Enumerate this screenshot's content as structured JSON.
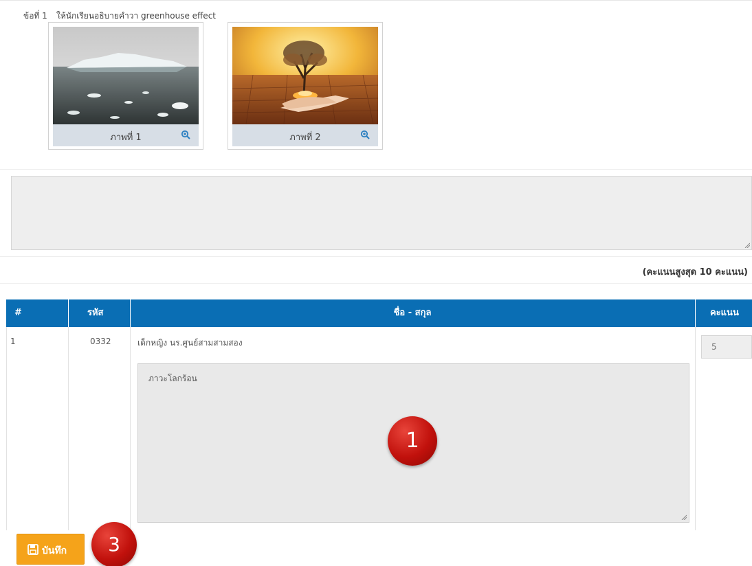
{
  "question": {
    "number_label": "ข้อที่ 1",
    "text": "ให้นักเรียนอธิบายคำวา greenhouse effect",
    "images": [
      {
        "caption": "ภาพที่ 1",
        "icon": "zoom-in-icon",
        "subject": "iceberg"
      },
      {
        "caption": "ภาพที่ 2",
        "icon": "zoom-in-icon",
        "subject": "tree-in-hands"
      }
    ],
    "answer_value": ""
  },
  "max_score_text": "(คะแนนสูงสุด 10 คะแนน)",
  "table": {
    "headers": [
      "#",
      "รหัส",
      "ชื่อ - สกุล",
      "คะแนน"
    ],
    "rows": [
      {
        "index": "1",
        "code": "0332",
        "name": "เด็กหญิง นร.ศูนย์สามสามสอง",
        "response": "ภาวะโลกร้อน",
        "score": "5"
      }
    ]
  },
  "save_button": {
    "label": "บันทึก",
    "icon": "floppy-disk-icon"
  },
  "badges": {
    "one": "1",
    "three": "3"
  },
  "colors": {
    "header_blue": "#0a6eb4",
    "save_orange": "#f5a31a",
    "badge_red": "#c1110c"
  }
}
